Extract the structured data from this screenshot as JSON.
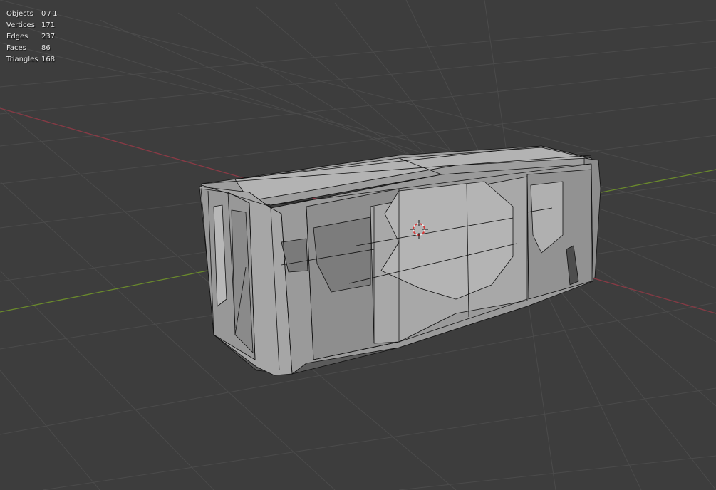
{
  "stats": [
    {
      "label": "Objects",
      "value": "0 / 1"
    },
    {
      "label": "Vertices",
      "value": "171"
    },
    {
      "label": "Edges",
      "value": "237"
    },
    {
      "label": "Faces",
      "value": "86"
    },
    {
      "label": "Triangles",
      "value": "168"
    }
  ],
  "colors": {
    "background": "#3d3d3d",
    "grid": "#4b4b4b",
    "x_axis": "#8a3a45",
    "y_axis": "#6a8a2c",
    "mesh_light": "#a2a2a2",
    "mesh_dark": "#6c6c6c",
    "wire": "#111111"
  },
  "icons": {
    "cursor": "3d-cursor-icon"
  }
}
